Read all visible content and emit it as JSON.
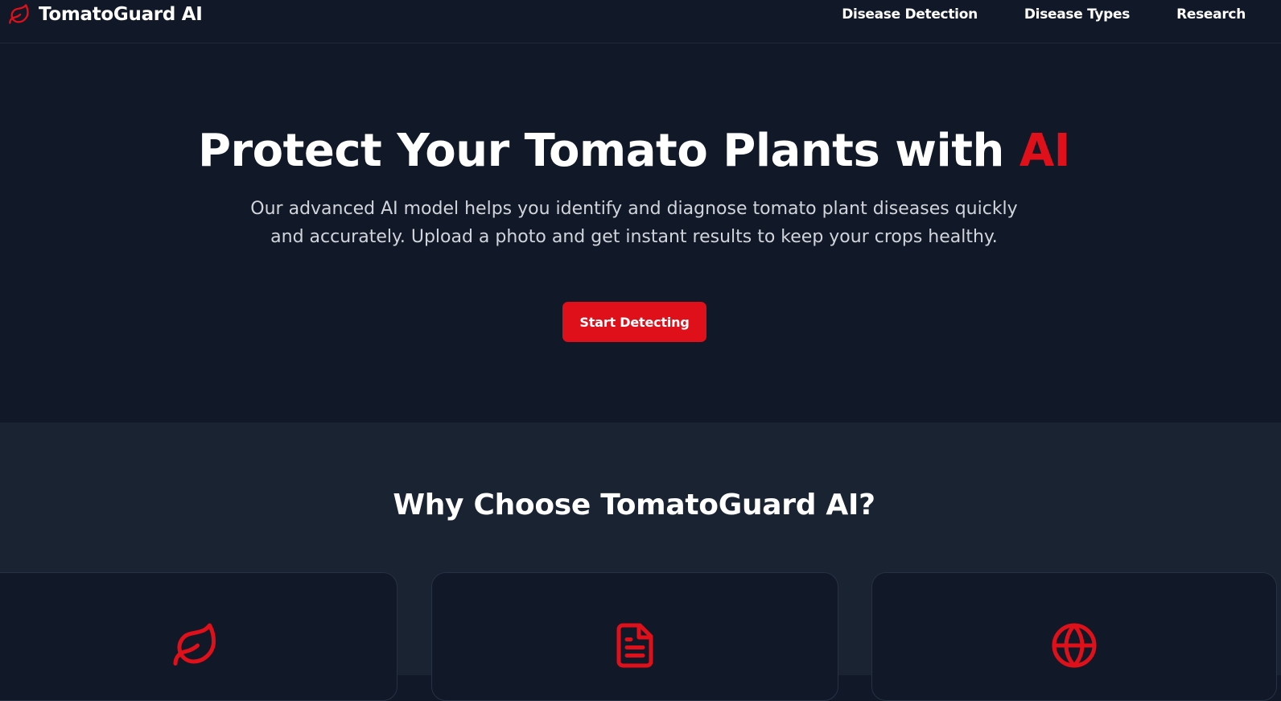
{
  "nav": {
    "brand": "TomatoGuard AI",
    "links": [
      "Disease Detection",
      "Disease Types",
      "Research"
    ]
  },
  "hero": {
    "title_main": "Protect Your Tomato Plants with ",
    "title_accent": "AI",
    "subtitle": "Our advanced AI model helps you identify and diagnose tomato plant diseases quickly and accurately. Upload a photo and get instant results to keep your crops healthy.",
    "cta": "Start Detecting"
  },
  "features": {
    "title": "Why Choose TomatoGuard AI?",
    "cards": [
      {
        "icon": "leaf-icon"
      },
      {
        "icon": "document-icon"
      },
      {
        "icon": "globe-icon"
      }
    ]
  },
  "colors": {
    "background": "#111827",
    "section_background": "#1a2332",
    "accent": "#e0101a",
    "text": "#ffffff",
    "muted_text": "#d1d5db"
  }
}
